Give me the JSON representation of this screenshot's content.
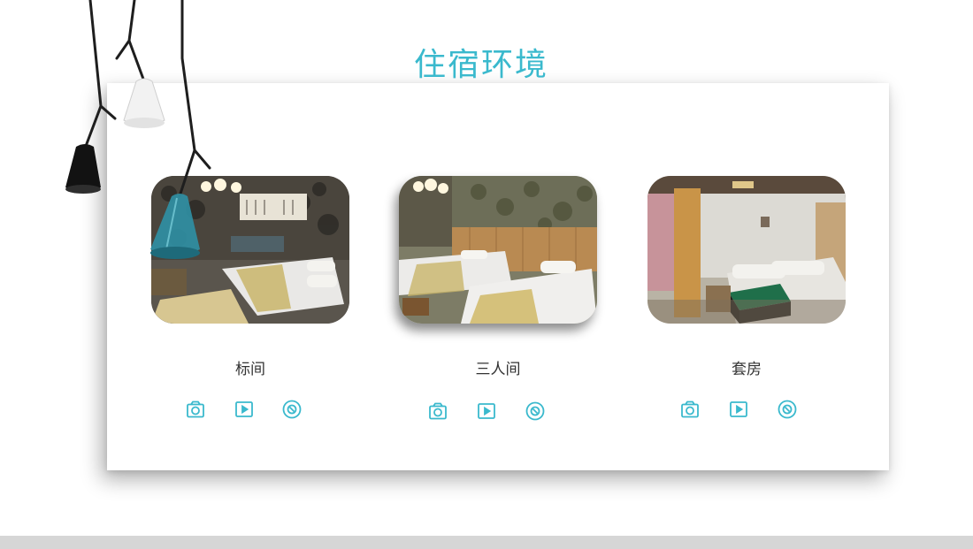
{
  "page": {
    "title": "住宿环境"
  },
  "rooms": [
    {
      "name": "标间",
      "icons": [
        "camera-icon",
        "play-icon",
        "panorama-icon"
      ]
    },
    {
      "name": "三人间",
      "icons": [
        "camera-icon",
        "play-icon",
        "panorama-icon"
      ]
    },
    {
      "name": "套房",
      "icons": [
        "camera-icon",
        "play-icon",
        "panorama-icon"
      ]
    }
  ],
  "colors": {
    "accent": "#3ab9cd",
    "text": "#333333",
    "footer_bar": "#d6d6d6"
  }
}
